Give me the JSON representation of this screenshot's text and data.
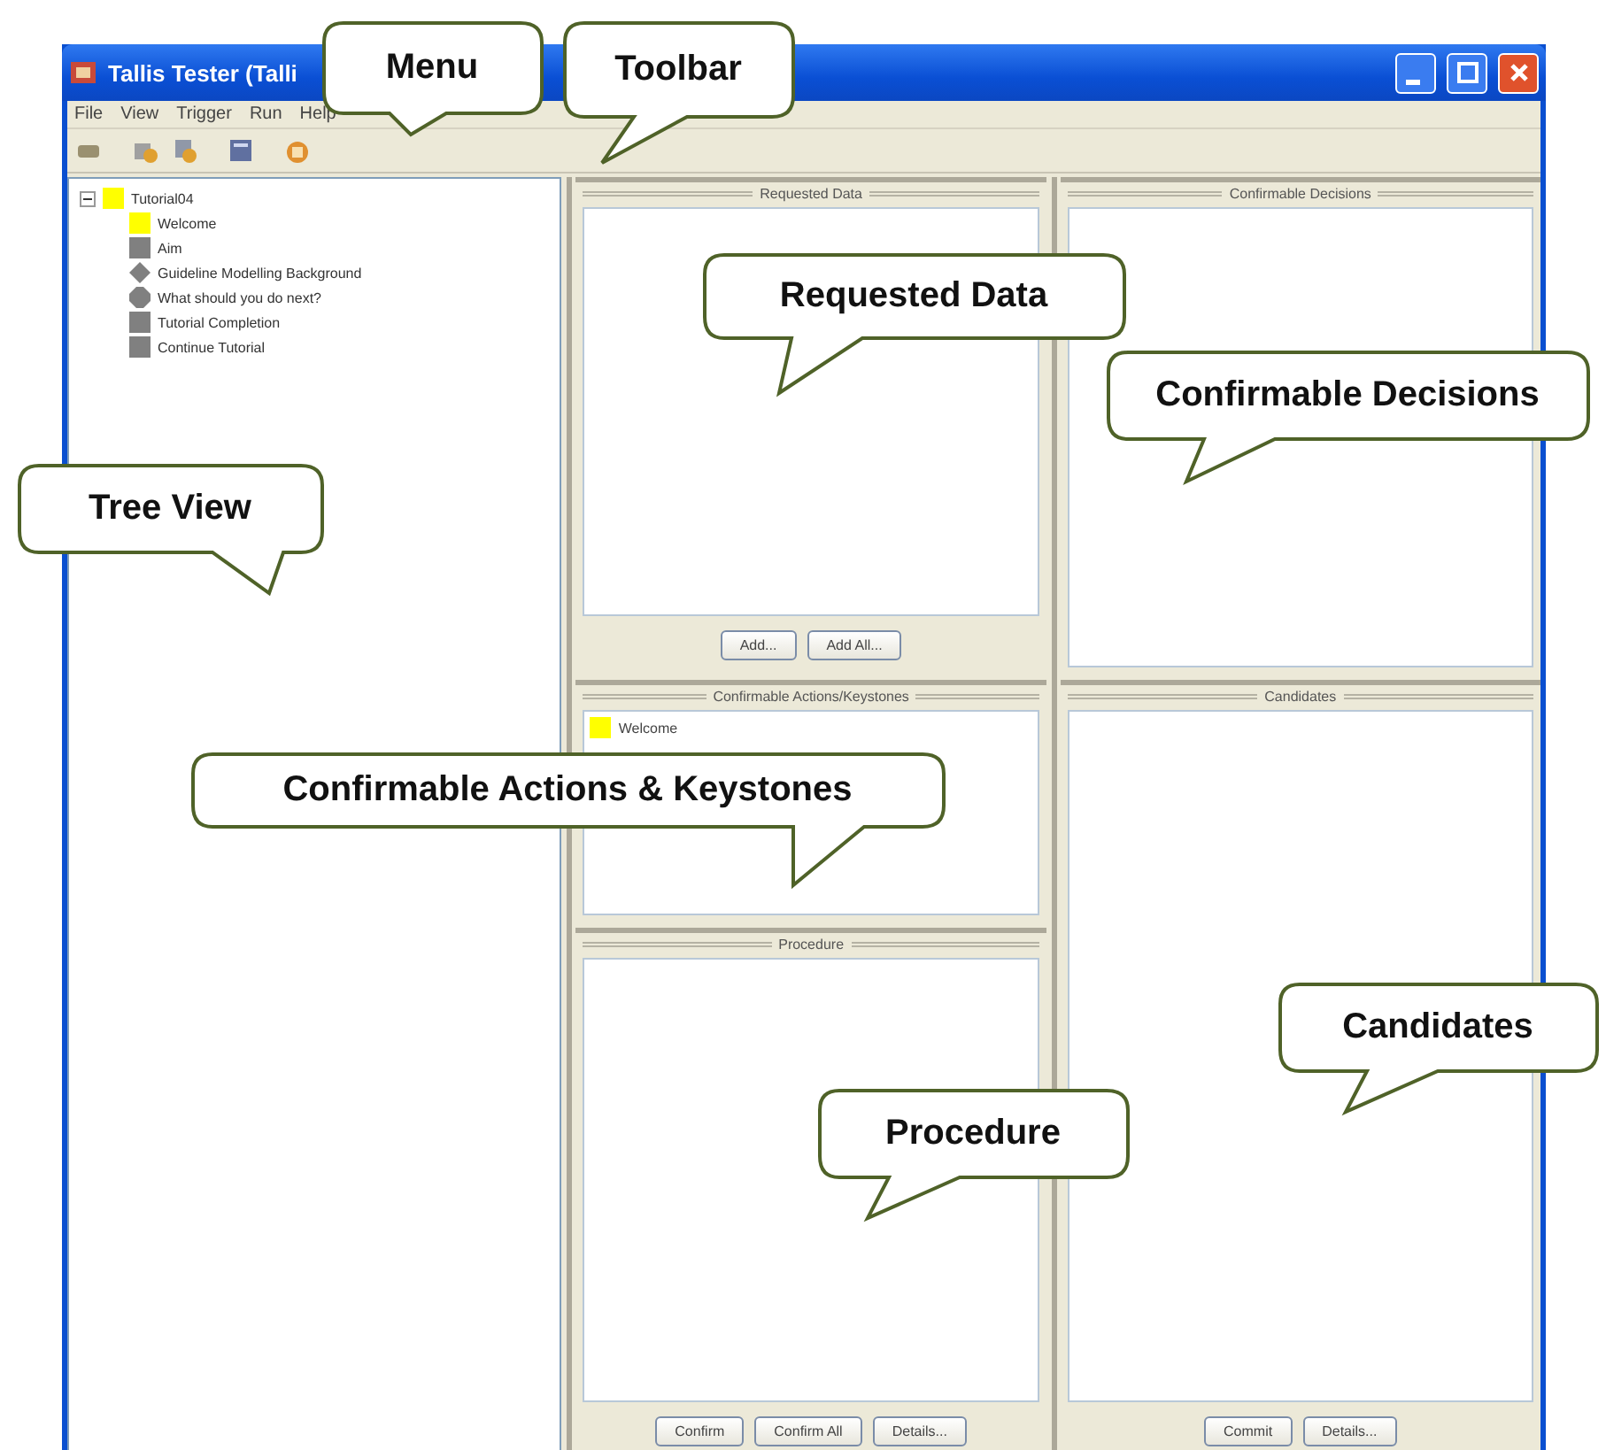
{
  "window": {
    "title": "Tallis Tester (Talli"
  },
  "menu": [
    "File",
    "View",
    "Trigger",
    "Run",
    "Help"
  ],
  "tree": {
    "label": "Tutorial04",
    "expanded": true,
    "color": "#ffff00",
    "children": [
      {
        "label": "Welcome",
        "kind": "square",
        "color": "#ffff00"
      },
      {
        "label": "Aim",
        "kind": "square",
        "color": "#808080"
      },
      {
        "label": "Guideline Modelling Background",
        "kind": "diamond",
        "color": "#808080"
      },
      {
        "label": "What should you do next?",
        "kind": "octagon",
        "color": "#808080"
      },
      {
        "label": "Tutorial Completion",
        "kind": "square",
        "color": "#808080"
      },
      {
        "label": "Continue Tutorial",
        "kind": "square",
        "color": "#808080"
      }
    ]
  },
  "requested_data": {
    "title": "Requested Data",
    "buttons": [
      "Add...",
      "Add All..."
    ]
  },
  "confirmable_decisions": {
    "title": "Confirmable Decisions"
  },
  "confirmable_actions": {
    "title": "Confirmable Actions/Keystones",
    "items": [
      {
        "label": "Welcome",
        "color": "#ffff00"
      }
    ]
  },
  "procedure": {
    "title": "Procedure",
    "buttons": [
      "Confirm",
      "Confirm All",
      "Details..."
    ]
  },
  "candidates": {
    "title": "Candidates",
    "buttons": [
      "Commit",
      "Details..."
    ]
  },
  "callouts": [
    "Menu",
    "Toolbar",
    "Requested Data",
    "Confirmable Decisions",
    "Tree View",
    "Confirmable Actions & Keystones",
    "Candidates",
    "Procedure"
  ]
}
